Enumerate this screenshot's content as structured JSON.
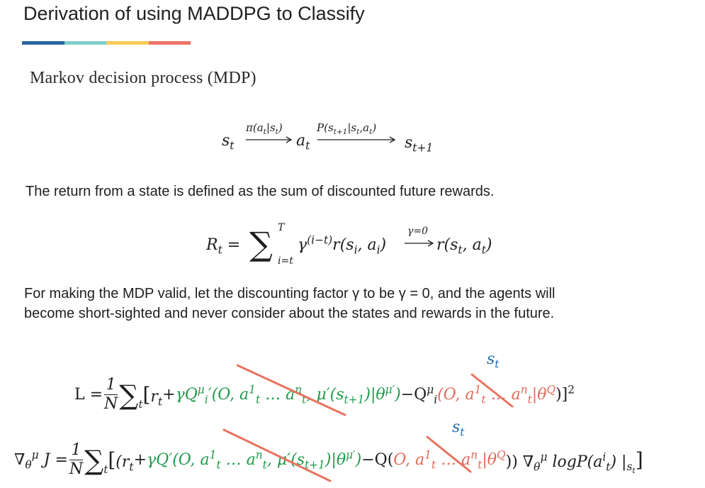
{
  "slide": {
    "title": "Derivation of using MADDPG to Classify",
    "accent_colors": [
      "#2a66a0",
      "#7fcfc8",
      "#f5cd5a",
      "#ec7565"
    ],
    "subtitle": "Markov decision process (MDP)",
    "mdp_chain": {
      "s_t": "s",
      "s_t_sub": "t",
      "pi_label": "π(a",
      "pi_label_sub1": "t",
      "pi_label_mid": "|s",
      "pi_label_sub2": "t",
      "pi_label_end": ")",
      "a_t": "a",
      "a_t_sub": "t",
      "p_label": "P(s",
      "p_label_sub1": "t+1",
      "p_label_mid": "|s",
      "p_label_sub2": "t",
      "p_label_mid2": ",a",
      "p_label_sub3": "t",
      "p_label_end": ")",
      "s_next": "s",
      "s_next_sub": "t+1"
    },
    "return_text": "The return from a state is defined as the sum of discounted future rewards.",
    "return_eq": {
      "lhs": "R",
      "lhs_sub": "t",
      "eq": "=",
      "sum_upper": "T",
      "sum_lower": "i=t",
      "term_gamma": "γ",
      "term_gamma_exp": "(i−t)",
      "term_r": "r(s",
      "term_r_sub1": "i",
      "term_r_mid": ", a",
      "term_r_sub2": "i",
      "term_r_end": ")",
      "arrow_label": "γ=0",
      "rhs": "r(s",
      "rhs_sub1": "t",
      "rhs_mid": ", a",
      "rhs_sub2": "t",
      "rhs_end": ")"
    },
    "valid_text_line1": "For making the MDP valid, let the discounting factor γ to be γ = 0, and the agents will",
    "valid_text_line2": "become short-sighted and never consider about the states and rewards in the future.",
    "loss_eq": {
      "lhs": "L =",
      "frac_num": "1",
      "frac_den": "N",
      "sum_sub": "t",
      "open": "[r",
      "open_sub": "t",
      "plus": " + ",
      "green_part": "γQ",
      "green_sup": "μ",
      "green_sub": "i",
      "green_rest": "′(O, a",
      "green_a_sup": "1",
      "green_a_sub": "t",
      "green_dots": " … a",
      "green_an_sup": "n",
      "green_an_sub": "t",
      "green_mu": ", μ′(s",
      "green_mu_sub": "t+1",
      "green_end": ")|θ",
      "green_theta_sup": "μ′",
      "green_close": ")",
      "minus": " − ",
      "q": "Q",
      "q_sup": "μ",
      "q_sub": "i",
      "red_part": "(O, a",
      "red_a_sup": "1",
      "red_a_sub": "t",
      "red_dots": " … a",
      "red_an_sup": "n",
      "red_an_sub": "t",
      "red_end": "|θ",
      "red_theta_sup": "Q",
      "close": ")]",
      "close_sup": "2",
      "annotation": "s",
      "annotation_sub": "t"
    },
    "grad_eq": {
      "lhs": "∇",
      "lhs_sub": "θ",
      "lhs_sub_sup": "μ",
      "lhs_j": "J =",
      "frac_num": "1",
      "frac_den": "N",
      "sum_sub": "t",
      "open": "[(r",
      "open_sub": "t",
      "plus": " + ",
      "green_part": "γQ′(O, a",
      "green_a_sup": "1",
      "green_a_sub": "t",
      "green_dots": " … a",
      "green_an_sup": "n",
      "green_an_sub": "t",
      "green_mu": ", μ′(s",
      "green_mu_sub": "t+1",
      "green_end": ")|θ",
      "green_theta_sup": "μ′",
      "green_close": ")",
      "minus": " − ",
      "q": "Q(",
      "red_part": "O, a",
      "red_a_sup": "1",
      "red_a_sub": "t",
      "red_dots": " … a",
      "red_an_sup": "n",
      "red_an_sub": "t",
      "red_end": "|θ",
      "red_theta_sup": "Q",
      "close": ")) ∇",
      "close_sub": "θ",
      "close_sub_sup": "μ",
      "log": " logP(a",
      "log_sup": "i",
      "log_sub": "t",
      "log_end": ") |",
      "log_end_sub": "s",
      "log_end_sub_sub": "t",
      "final": "]",
      "annotation": "s",
      "annotation_sub": "t"
    }
  }
}
